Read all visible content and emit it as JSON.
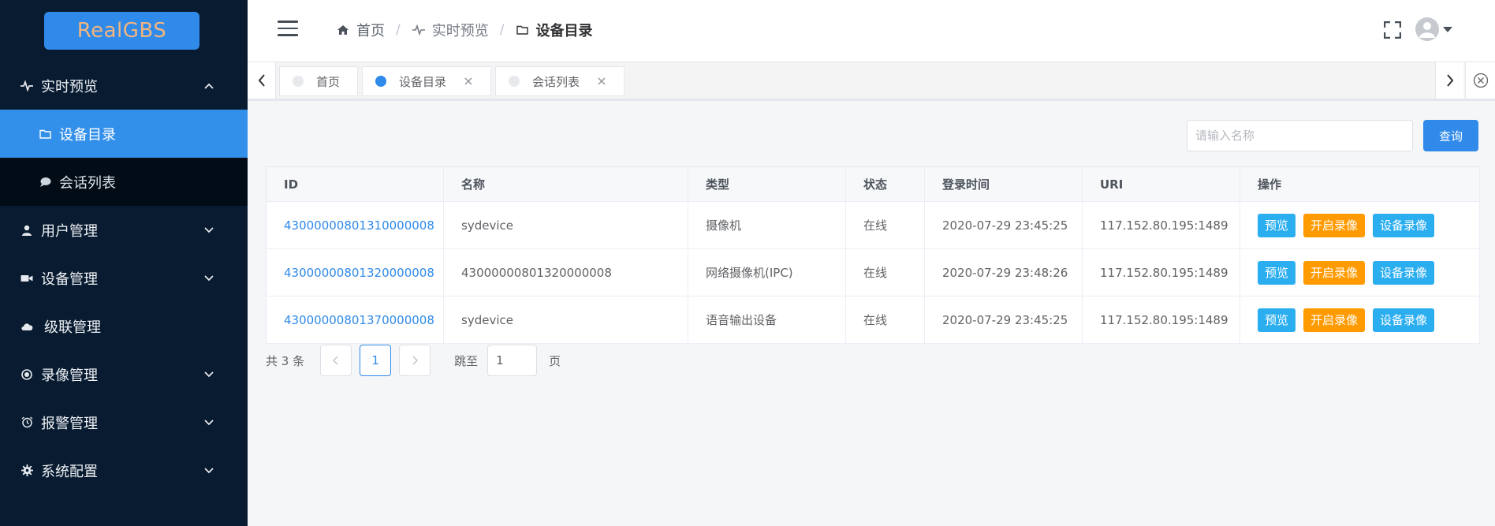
{
  "app": {
    "logo": "RealGBS"
  },
  "sidebar": {
    "items": [
      {
        "label": "实时预览",
        "icon": "pulse-icon",
        "expanded": true,
        "children": [
          {
            "label": "设备目录",
            "icon": "folder-icon",
            "active": true
          },
          {
            "label": "会话列表",
            "icon": "chat-icon",
            "active": false
          }
        ]
      },
      {
        "label": "用户管理",
        "icon": "user-icon"
      },
      {
        "label": "设备管理",
        "icon": "camera-icon"
      },
      {
        "label": "级联管理",
        "icon": "cloud-icon"
      },
      {
        "label": "录像管理",
        "icon": "record-icon"
      },
      {
        "label": "报警管理",
        "icon": "alarm-icon"
      },
      {
        "label": "系统配置",
        "icon": "gear-icon"
      }
    ]
  },
  "header": {
    "breadcrumb": [
      {
        "label": "首页",
        "icon": "home-icon"
      },
      {
        "label": "实时预览",
        "icon": "pulse-icon"
      },
      {
        "label": "设备目录",
        "icon": "folder-icon"
      }
    ],
    "separator": "/"
  },
  "tabs": [
    {
      "label": "首页",
      "active": false,
      "closable": false
    },
    {
      "label": "设备目录",
      "active": true,
      "closable": true
    },
    {
      "label": "会话列表",
      "active": false,
      "closable": true
    }
  ],
  "search": {
    "placeholder": "请输入名称",
    "value": "",
    "button_label": "查询"
  },
  "table": {
    "columns": [
      "ID",
      "名称",
      "类型",
      "状态",
      "登录时间",
      "URI",
      "操作"
    ],
    "rows": [
      {
        "id": "43000000801310000008",
        "name": "sydevice",
        "type": "摄像机",
        "status": "在线",
        "login_time": "2020-07-29 23:45:25",
        "uri": "117.152.80.195:1489"
      },
      {
        "id": "43000000801320000008",
        "name": "43000000801320000008",
        "type": "网络摄像机(IPC)",
        "status": "在线",
        "login_time": "2020-07-29 23:48:26",
        "uri": "117.152.80.195:1489"
      },
      {
        "id": "43000000801370000008",
        "name": "sydevice",
        "type": "语音输出设备",
        "status": "在线",
        "login_time": "2020-07-29 23:45:25",
        "uri": "117.152.80.195:1489"
      }
    ],
    "actions": [
      "预览",
      "开启录像",
      "设备录像"
    ]
  },
  "pagination": {
    "total_text": "共 3 条",
    "current_page": "1",
    "jump_label": "跳至",
    "jump_value": "1",
    "page_suffix": "页"
  },
  "colors": {
    "sidebar_bg": "#081b30",
    "accent": "#2f8ae9",
    "record_btn": "#ff9a00",
    "preview_btn": "#2baef0"
  }
}
